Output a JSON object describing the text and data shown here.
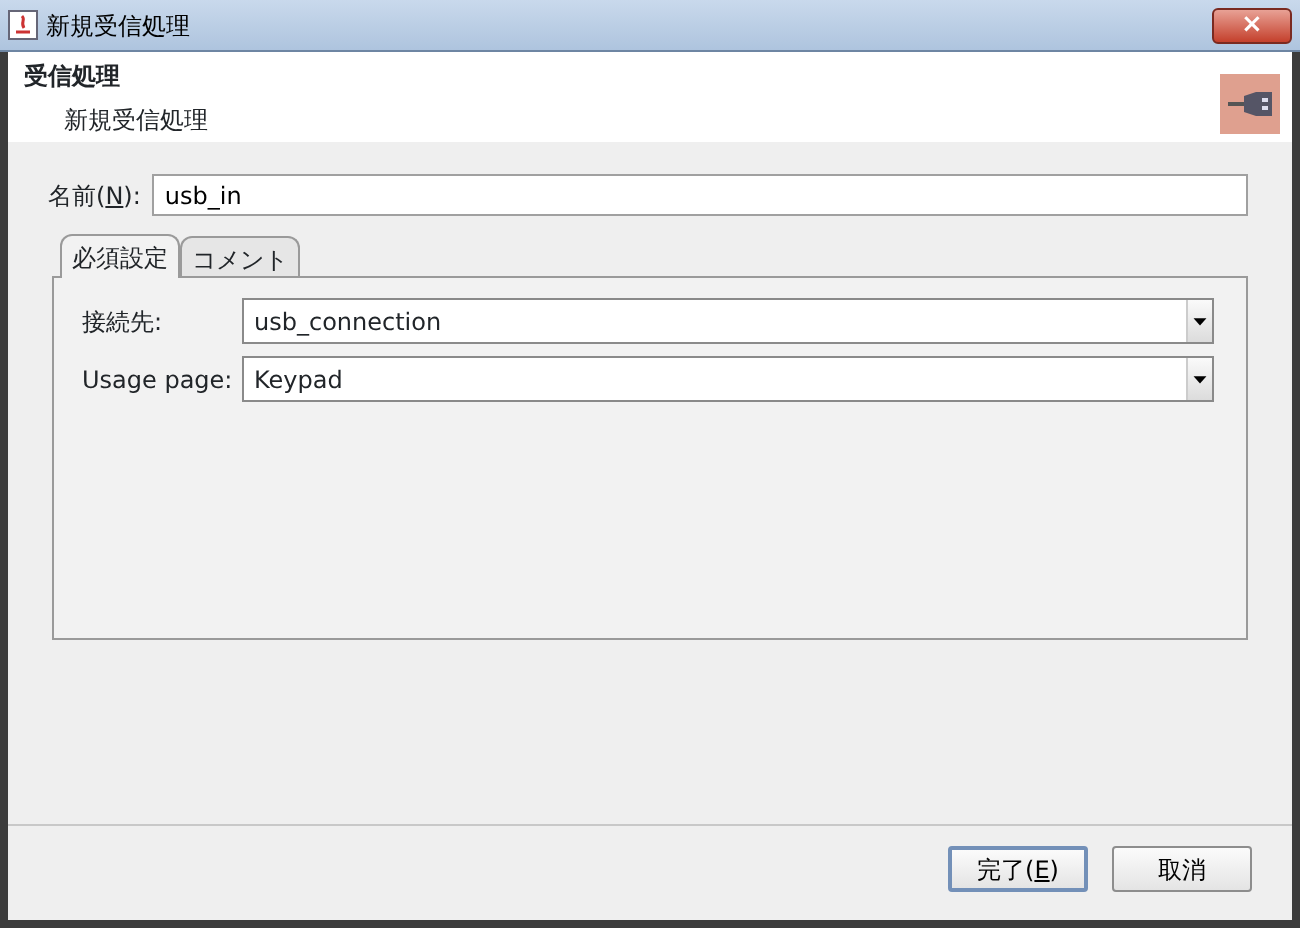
{
  "window": {
    "title": "新規受信処理",
    "close": "×"
  },
  "header": {
    "title": "受信処理",
    "subtitle": "新規受信処理"
  },
  "name_field": {
    "label_before": "名前(",
    "mnemonic": "N",
    "label_after": "):",
    "value": "usb_in"
  },
  "tabs": [
    {
      "label": "必須設定",
      "selected": true
    },
    {
      "label": "コメント",
      "selected": false
    }
  ],
  "fields": [
    {
      "label": "接続先:",
      "value": "usb_connection"
    },
    {
      "label": "Usage page:",
      "value": "Keypad"
    }
  ],
  "buttons": [
    {
      "label_before": "完了(",
      "mnemonic": "E",
      "label_after": ")",
      "default": true
    },
    {
      "label_before": "取消",
      "default": false
    }
  ]
}
